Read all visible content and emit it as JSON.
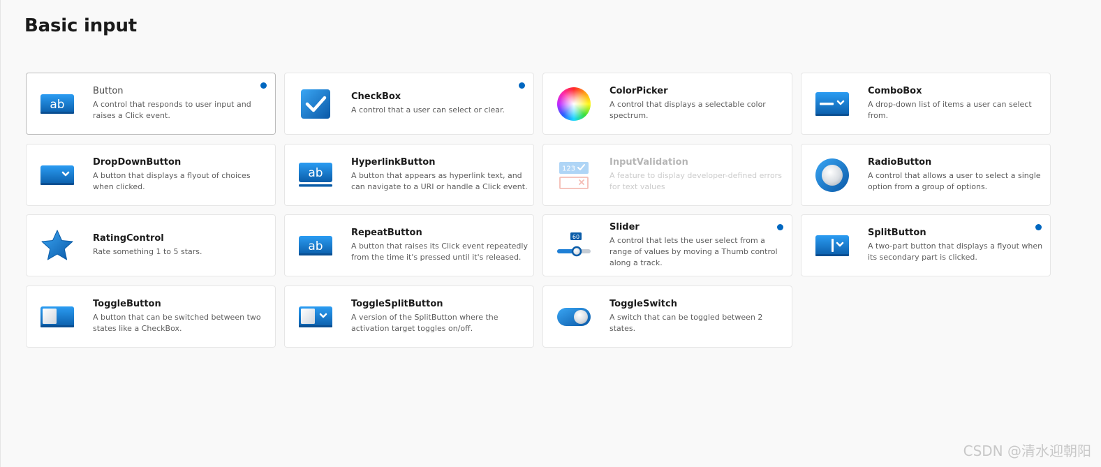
{
  "page": {
    "title": "Basic input"
  },
  "cards": [
    {
      "title": "Button",
      "description": "A control that responds to user input and raises a Click event.",
      "icon": "button-ab-icon",
      "new": true
    },
    {
      "title": "CheckBox",
      "description": "A control that a user can select or clear.",
      "icon": "checkbox-icon",
      "new": true
    },
    {
      "title": "ColorPicker",
      "description": "A control that displays a selectable color spectrum.",
      "icon": "color-wheel-icon",
      "new": false
    },
    {
      "title": "ComboBox",
      "description": "A drop-down list of items a user can select from.",
      "icon": "combobox-icon",
      "new": false
    },
    {
      "title": "DropDownButton",
      "description": "A button that displays a flyout of choices when clicked.",
      "icon": "dropdown-button-icon",
      "new": false
    },
    {
      "title": "HyperlinkButton",
      "description": "A button that appears as hyperlink text, and can navigate to a URI or handle a Click event.",
      "icon": "hyperlink-button-icon",
      "new": false
    },
    {
      "title": "InputValidation",
      "description": "A feature to display developer-defined errors for text values",
      "icon": "input-validation-icon",
      "new": false,
      "disabled": true
    },
    {
      "title": "RadioButton",
      "description": "A control that allows a user to select a single option from a group of options.",
      "icon": "radio-button-icon",
      "new": false
    },
    {
      "title": "RatingControl",
      "description": "Rate something 1 to 5 stars.",
      "icon": "star-icon",
      "new": false
    },
    {
      "title": "RepeatButton",
      "description": "A button that raises its Click event repeatedly from the time it's pressed until it's released.",
      "icon": "repeat-button-icon",
      "new": false
    },
    {
      "title": "Slider",
      "description": "A control that lets the user select from a range of values by moving a Thumb control along a track.",
      "icon": "slider-icon",
      "new": true,
      "icon_value": "60"
    },
    {
      "title": "SplitButton",
      "description": "A two-part button that displays a flyout when its secondary part is clicked.",
      "icon": "split-button-icon",
      "new": true
    },
    {
      "title": "ToggleButton",
      "description": "A button that can be switched between two states like a CheckBox.",
      "icon": "toggle-button-icon",
      "new": false
    },
    {
      "title": "ToggleSplitButton",
      "description": "A version of the SplitButton where the activation target toggles on/off.",
      "icon": "toggle-split-button-icon",
      "new": false
    },
    {
      "title": "ToggleSwitch",
      "description": "A switch that can be toggled between 2 states.",
      "icon": "toggle-switch-icon",
      "new": false
    }
  ],
  "input_validation_icon": {
    "value": "123"
  },
  "watermark": "CSDN @清水迎朝阳",
  "colors": {
    "accent": "#0067c0",
    "icon_blue_light": "#2b9cf2",
    "icon_blue_dark": "#0a5ca8",
    "background": "#f9f9f9"
  }
}
